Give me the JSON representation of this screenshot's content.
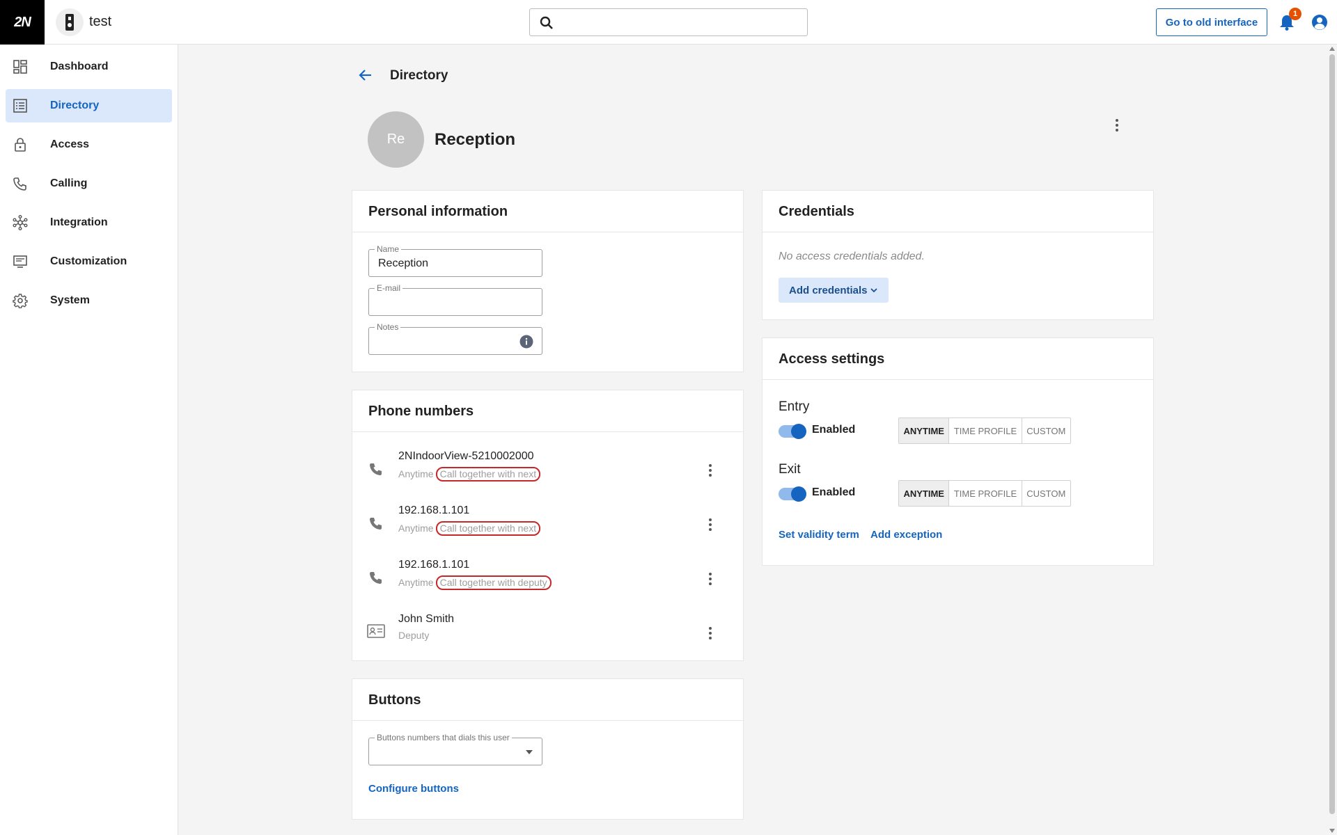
{
  "header": {
    "logo": "2N",
    "device_name": "test",
    "search_placeholder": "",
    "old_interface_label": "Go to old interface",
    "notification_count": "1"
  },
  "sidebar": {
    "items": [
      {
        "label": "Dashboard",
        "icon": "dashboard-icon",
        "active": false
      },
      {
        "label": "Directory",
        "icon": "directory-icon",
        "active": true
      },
      {
        "label": "Access",
        "icon": "lock-icon",
        "active": false
      },
      {
        "label": "Calling",
        "icon": "phone-icon",
        "active": false
      },
      {
        "label": "Integration",
        "icon": "integration-icon",
        "active": false
      },
      {
        "label": "Customization",
        "icon": "customization-icon",
        "active": false
      },
      {
        "label": "System",
        "icon": "gear-icon",
        "active": false
      }
    ]
  },
  "page": {
    "breadcrumb": "Directory",
    "avatar_initials": "Re",
    "title": "Reception"
  },
  "personal": {
    "title": "Personal information",
    "name_label": "Name",
    "name_value": "Reception",
    "email_label": "E-mail",
    "email_value": "",
    "notes_label": "Notes",
    "notes_value": ""
  },
  "phones": {
    "title": "Phone numbers",
    "rows": [
      {
        "title": "2NIndoorView-5210002000",
        "time": "Anytime",
        "mode": "Call together with next",
        "icon": "phone-icon"
      },
      {
        "title": "192.168.1.101",
        "time": "Anytime",
        "mode": "Call together with next",
        "icon": "phone-icon"
      },
      {
        "title": "192.168.1.101",
        "time": "Anytime",
        "mode": "Call together with deputy",
        "icon": "phone-icon"
      },
      {
        "title": "John Smith",
        "time": "Deputy",
        "mode": "",
        "icon": "contact-card-icon"
      }
    ]
  },
  "buttons": {
    "title": "Buttons",
    "select_label": "Buttons numbers that dials this user",
    "select_value": "",
    "configure_label": "Configure buttons"
  },
  "credentials": {
    "title": "Credentials",
    "empty_text": "No access credentials added.",
    "add_label": "Add credentials"
  },
  "access": {
    "title": "Access settings",
    "entry": {
      "label": "Entry",
      "status": "Enabled",
      "enabled": true,
      "options": [
        "ANYTIME",
        "TIME PROFILE",
        "CUSTOM"
      ],
      "selected": "ANYTIME"
    },
    "exit": {
      "label": "Exit",
      "status": "Enabled",
      "enabled": true,
      "options": [
        "ANYTIME",
        "TIME PROFILE",
        "CUSTOM"
      ],
      "selected": "ANYTIME"
    },
    "validity_label": "Set validity term",
    "exception_label": "Add exception"
  },
  "colors": {
    "accent": "#1565c0",
    "active_nav_bg": "#dbe8fb",
    "highlight_outline": "#c62828",
    "badge": "#e65100"
  }
}
